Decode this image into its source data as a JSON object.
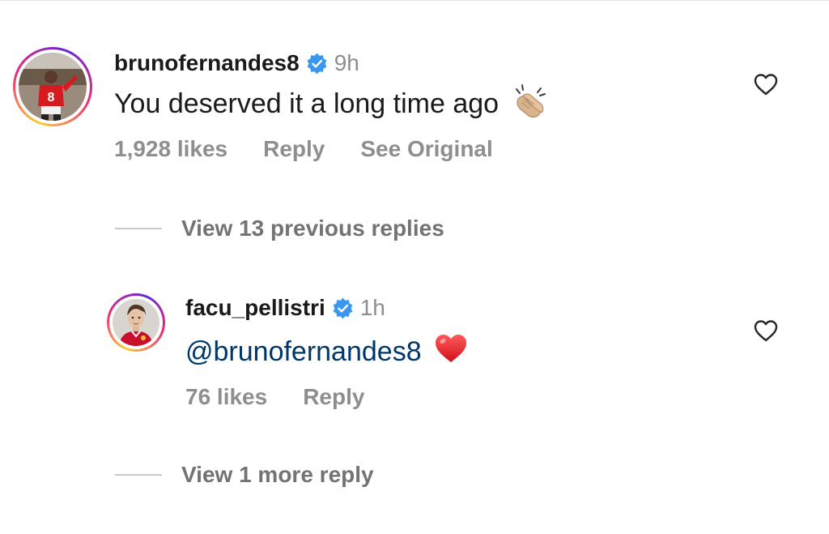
{
  "comments": [
    {
      "username": "brunofernandes8",
      "time": "9h",
      "text": "You deserved it a long time ago",
      "emoji": "clapping-hands",
      "likes": "1,928 likes",
      "reply": "Reply",
      "see_original": "See Original"
    },
    {
      "username": "facu_pellistri",
      "time": "1h",
      "text": "@brunofernandes8",
      "emoji": "red-heart",
      "likes": "76 likes",
      "reply": "Reply"
    }
  ],
  "view_previous": "View 13 previous replies",
  "view_more": "View 1 more reply",
  "colors": {
    "verified": "#3897f0",
    "mention": "#00376b",
    "muted": "#8e8e8e"
  }
}
